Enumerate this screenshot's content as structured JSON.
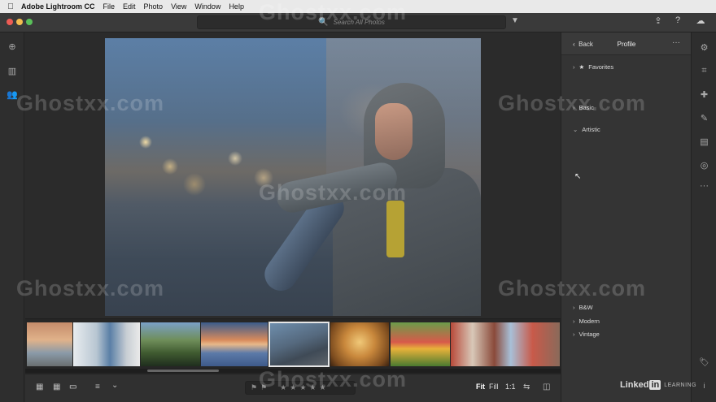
{
  "menubar": {
    "apple_icon": "apple-icon",
    "app_name": "Adobe Lightroom CC",
    "menus": [
      "File",
      "Edit",
      "Photo",
      "View",
      "Window",
      "Help"
    ]
  },
  "toolbar": {
    "search_placeholder": "Search All Photos",
    "search_icon": "🔍",
    "filter_icon": "▼",
    "share_icon": "⇪",
    "help_icon": "?",
    "cloud_icon": "☁"
  },
  "left_rail": {
    "add_icon": "⊕",
    "library_icon": "▥",
    "people_icon": "👥"
  },
  "panel": {
    "back_label": "Back",
    "title": "Profile",
    "more_icon": "···",
    "groups": [
      {
        "label": "Favorites",
        "star": "★",
        "chevron": "›"
      },
      {
        "label": "Basic",
        "chevron": "›"
      },
      {
        "label": "Artistic",
        "chevron": "⌄"
      },
      {
        "label": "B&W",
        "chevron": "›"
      },
      {
        "label": "Modern",
        "chevron": "›"
      },
      {
        "label": "Vintage",
        "chevron": "›"
      }
    ]
  },
  "right_rail": {
    "edit_icon": "⚙",
    "crop_icon": "⌗",
    "heal_icon": "✚",
    "brush_icon": "✎",
    "linear_gradient_icon": "▤",
    "radial_gradient_icon": "◎",
    "more_icon": "···",
    "tag_icon": "🏷",
    "info_icon": "i"
  },
  "bottom_bar": {
    "square_grid_icon": "▦",
    "photo_grid_icon": "▦",
    "detail_icon": "▭",
    "sort_icon": "≡",
    "sort_chevron": "⌄",
    "flag_icon": "⚑",
    "reject_icon": "⚑",
    "stars": [
      "★",
      "★",
      "★",
      "★",
      "★"
    ],
    "fit_label": "Fit",
    "fill_label": "Fill",
    "ratio_label": "1:1",
    "compare_icon": "⇆",
    "before_after_icon": "◫"
  },
  "branding": {
    "linkedin_text": "Linked",
    "linkedin_in": "in",
    "learning_text": "LEARNING"
  },
  "watermark": "Ghostxx.com",
  "colors": {
    "menubar_bg": "#e9e9e9",
    "panel_bg": "#343434",
    "canvas_bg": "#2b2b2b",
    "selection_outline": "#e6e6e6"
  }
}
